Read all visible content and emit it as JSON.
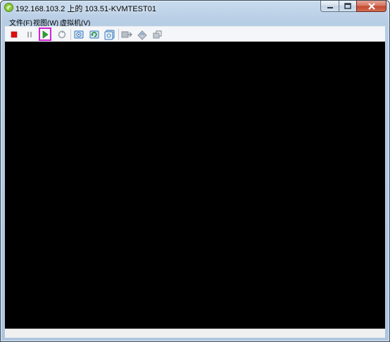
{
  "window": {
    "title": "192.168.103.2 上的 103.51-KVMTEST01"
  },
  "menubar": {
    "items": [
      {
        "label": "文件(F)"
      },
      {
        "label": "视图(W)"
      },
      {
        "label": "虚拟机(V)"
      }
    ]
  },
  "toolbar": {
    "buttons": [
      {
        "icon": "stop-icon",
        "enabled": true
      },
      {
        "icon": "pause-icon",
        "enabled": false
      },
      {
        "icon": "play-icon",
        "enabled": true,
        "highlighted": true
      },
      {
        "icon": "reset-icon",
        "enabled": false
      },
      {
        "icon": "snapshot-take-icon",
        "enabled": true
      },
      {
        "icon": "snapshot-revert-icon",
        "enabled": true
      },
      {
        "icon": "snapshot-manager-icon",
        "enabled": true
      },
      {
        "icon": "connect-cd-icon",
        "enabled": false
      },
      {
        "icon": "connect-floppy-icon",
        "enabled": false
      },
      {
        "icon": "connect-network-icon",
        "enabled": false
      }
    ]
  },
  "colors": {
    "highlight": "#d322d8",
    "console_bg": "#000000",
    "stop_red": "#e01010",
    "play_green": "#2aa32a"
  }
}
